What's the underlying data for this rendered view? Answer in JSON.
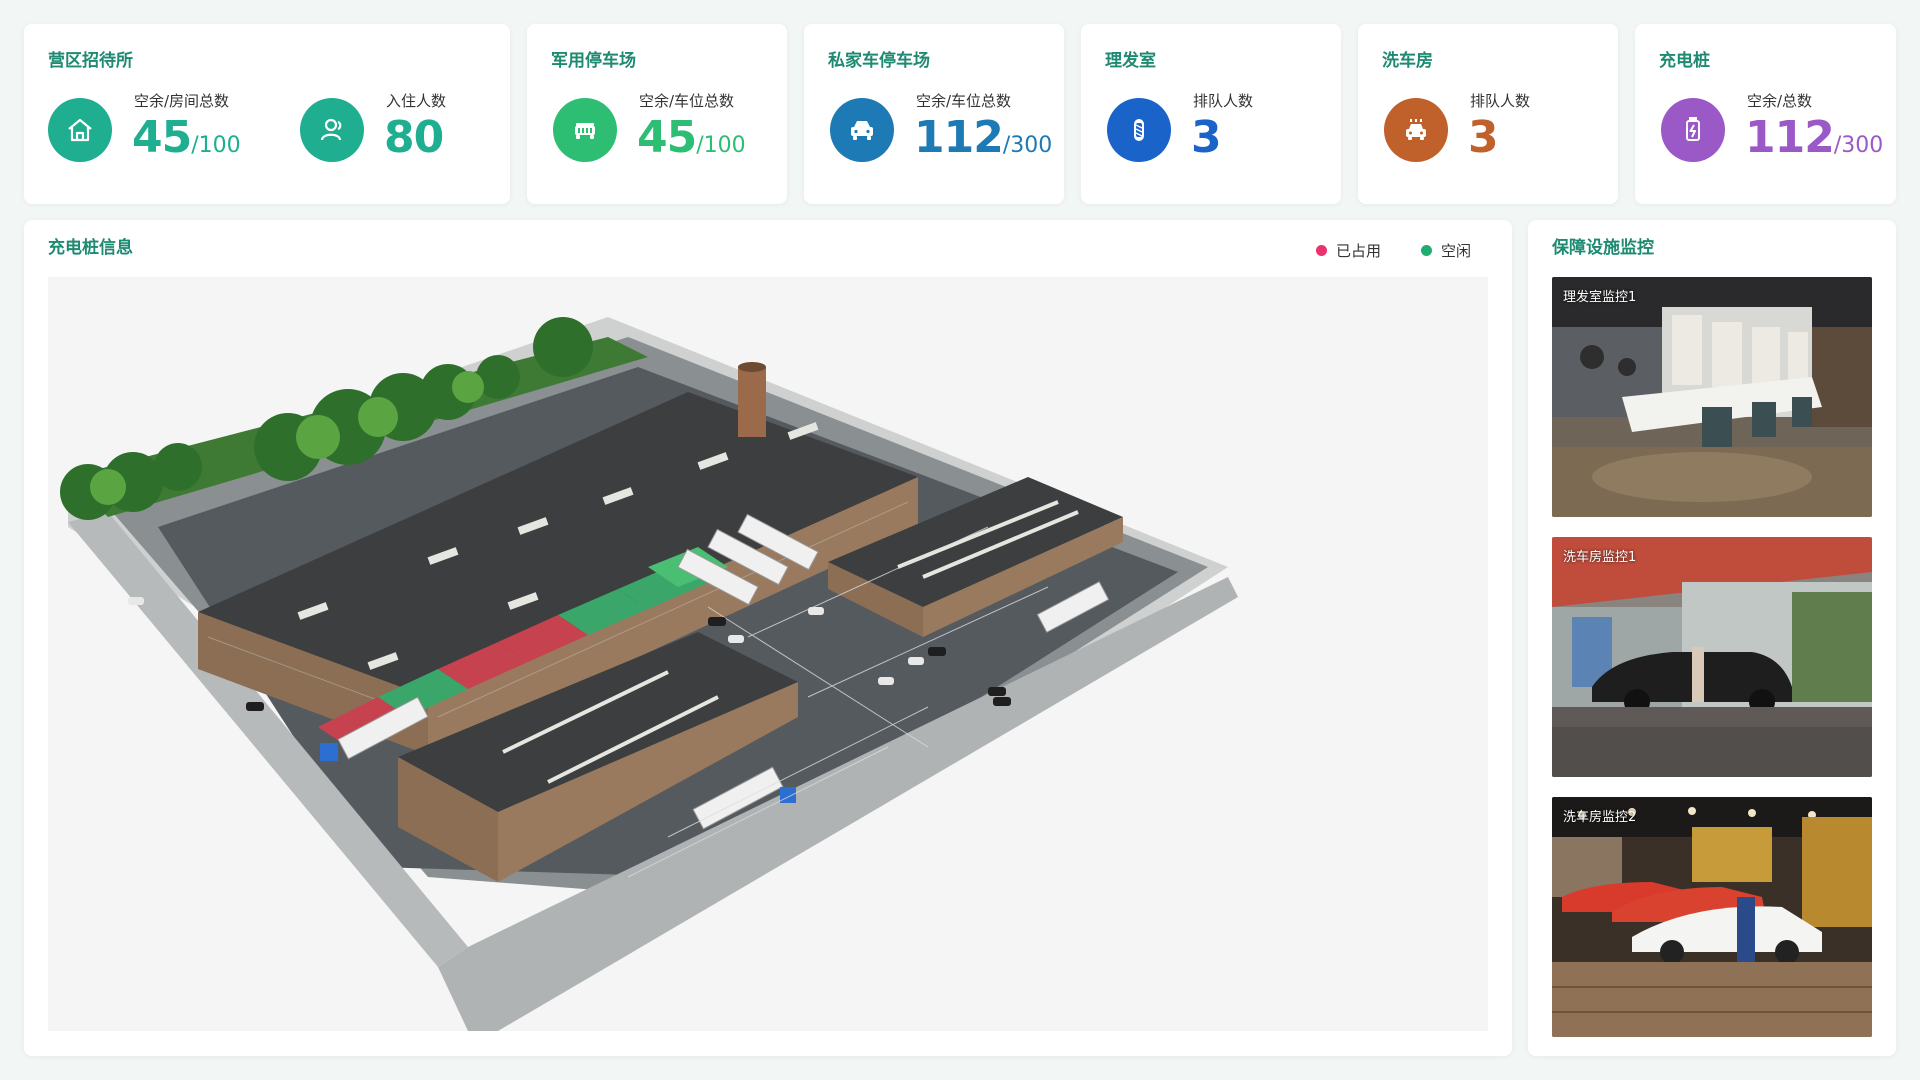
{
  "colors": {
    "teal": "#1fae8f",
    "green": "#2dbd73",
    "blue_dark": "#1e7ab5",
    "blue": "#1a63c8",
    "orange": "#c0602a",
    "purple": "#9b59c7",
    "occupied": "#e8336d",
    "free": "#1fae6f",
    "title": "#1f8a72"
  },
  "cards": {
    "guesthouse": {
      "title": "营区招待所",
      "stats": [
        {
          "icon": "house-icon",
          "label": "空余/房间总数",
          "value": "45",
          "total": "/100"
        },
        {
          "icon": "person-icon",
          "label": "入住人数",
          "value": "80",
          "total": ""
        }
      ]
    },
    "military_parking": {
      "title": "军用停车场",
      "stat": {
        "icon": "jeep-icon",
        "label": "空余/车位总数",
        "value": "45",
        "total": "/100"
      }
    },
    "private_parking": {
      "title": "私家车停车场",
      "stat": {
        "icon": "car-icon",
        "label": "空余/车位总数",
        "value": "112",
        "total": "/300"
      }
    },
    "barber": {
      "title": "理发室",
      "stat": {
        "icon": "barber-pole-icon",
        "label": "排队人数",
        "value": "3",
        "total": ""
      }
    },
    "carwash": {
      "title": "洗车房",
      "stat": {
        "icon": "car-wash-icon",
        "label": "排队人数",
        "value": "3",
        "total": ""
      }
    },
    "charging": {
      "title": "充电桩",
      "stat": {
        "icon": "battery-charging-icon",
        "label": "空余/总数",
        "value": "112",
        "total": "/300"
      }
    }
  },
  "map_panel": {
    "title": "充电桩信息",
    "legend": [
      {
        "label": "已占用",
        "color": "#e8336d"
      },
      {
        "label": "空闲",
        "color": "#1fae6f"
      }
    ]
  },
  "monitor_panel": {
    "title": "保障设施监控",
    "cameras": [
      {
        "label": "理发室监控1"
      },
      {
        "label": "洗车房监控1"
      },
      {
        "label": "洗车房监控2"
      }
    ]
  }
}
